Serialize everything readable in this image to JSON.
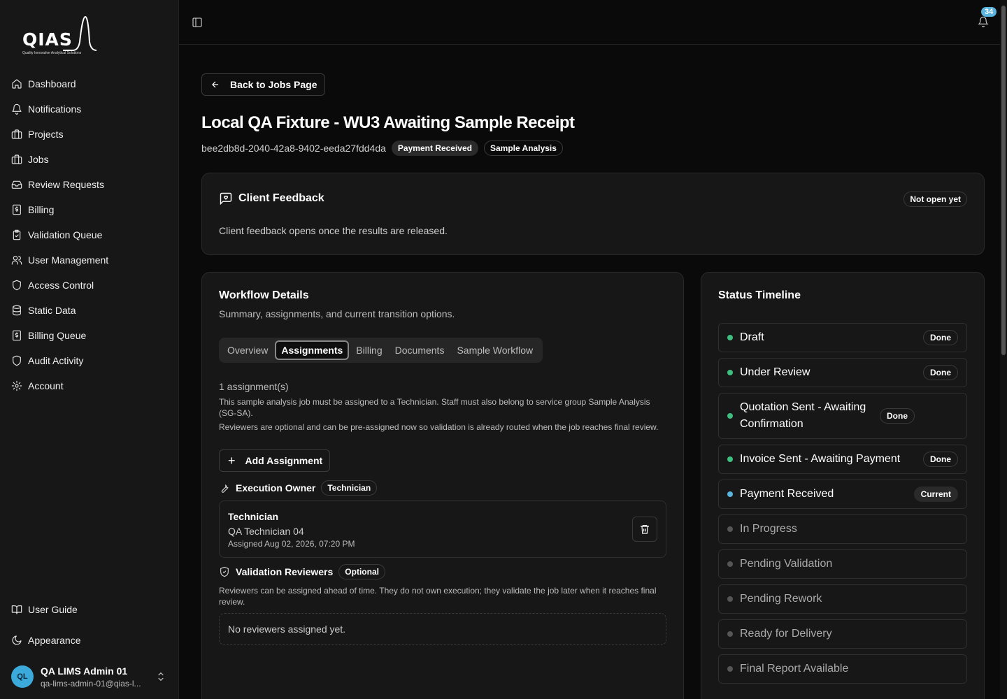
{
  "brand": {
    "name": "QIAS",
    "tagline": "Quality Innovative Analytical Solutions"
  },
  "sidebar": {
    "items": [
      {
        "label": "Dashboard",
        "icon": "home-icon"
      },
      {
        "label": "Notifications",
        "icon": "bell-icon"
      },
      {
        "label": "Projects",
        "icon": "briefcase-icon"
      },
      {
        "label": "Jobs",
        "icon": "briefcase-icon"
      },
      {
        "label": "Review Requests",
        "icon": "inbox-icon"
      },
      {
        "label": "Billing",
        "icon": "receipt-icon"
      },
      {
        "label": "Validation Queue",
        "icon": "clipboard-check-icon"
      },
      {
        "label": "User Management",
        "icon": "users-icon"
      },
      {
        "label": "Access Control",
        "icon": "shield-icon"
      },
      {
        "label": "Static Data",
        "icon": "database-icon"
      },
      {
        "label": "Billing Queue",
        "icon": "receipt-icon"
      },
      {
        "label": "Audit Activity",
        "icon": "shield-icon"
      },
      {
        "label": "Account",
        "icon": "gear-icon"
      }
    ],
    "bottom": [
      {
        "label": "User Guide",
        "icon": "book-icon"
      },
      {
        "label": "Appearance",
        "icon": "moon-icon"
      }
    ],
    "user": {
      "initials": "QL",
      "name": "QA LIMS Admin 01",
      "email": "qa-lims-admin-01@qias-l..."
    }
  },
  "topbar": {
    "notification_count": "34"
  },
  "page": {
    "back_label": "Back to Jobs Page",
    "title": "Local QA Fixture - WU3 Awaiting Sample Receipt",
    "job_id": "bee2db8d-2040-42a8-9402-eeda27fdd4da",
    "status_badge": "Payment Received",
    "type_badge": "Sample Analysis"
  },
  "feedback": {
    "title": "Client Feedback",
    "status": "Not open yet",
    "text": "Client feedback opens once the results are released."
  },
  "workflow": {
    "title": "Workflow Details",
    "subtitle": "Summary, assignments, and current transition options.",
    "tabs": [
      "Overview",
      "Assignments",
      "Billing",
      "Documents",
      "Sample Workflow"
    ],
    "active_tab": "Assignments",
    "assignment_count": "1 assignment(s)",
    "note1": "This sample analysis job must be assigned to a Technician. Staff must also belong to service group Sample Analysis (SG-SA).",
    "note2": "Reviewers are optional and can be pre-assigned now so validation is already routed when the job reaches final review.",
    "add_label": "Add Assignment",
    "owner": {
      "title": "Execution Owner",
      "badge": "Technician",
      "role": "Technician",
      "name": "QA Technician 04",
      "assigned": "Assigned Aug 02, 2026, 07:20 PM"
    },
    "reviewers": {
      "title": "Validation Reviewers",
      "badge": "Optional",
      "note": "Reviewers can be assigned ahead of time. They do not own execution; they validate the job later when it reaches final review.",
      "empty": "No reviewers assigned yet."
    }
  },
  "timeline": {
    "title": "Status Timeline",
    "colors": {
      "done": "#3fbf7f",
      "current": "#5ab4dd",
      "pending": "#555555"
    },
    "items": [
      {
        "label": "Draft",
        "state": "done",
        "badge": "Done"
      },
      {
        "label": "Under Review",
        "state": "done",
        "badge": "Done"
      },
      {
        "label": "Quotation Sent - Awaiting Confirmation",
        "state": "done",
        "badge": "Done"
      },
      {
        "label": "Invoice Sent - Awaiting Payment",
        "state": "done",
        "badge": "Done"
      },
      {
        "label": "Payment Received",
        "state": "current",
        "badge": "Current"
      },
      {
        "label": "In Progress",
        "state": "pending",
        "badge": ""
      },
      {
        "label": "Pending Validation",
        "state": "pending",
        "badge": ""
      },
      {
        "label": "Pending Rework",
        "state": "pending",
        "badge": ""
      },
      {
        "label": "Ready for Delivery",
        "state": "pending",
        "badge": ""
      },
      {
        "label": "Final Report Available",
        "state": "pending",
        "badge": ""
      }
    ]
  }
}
